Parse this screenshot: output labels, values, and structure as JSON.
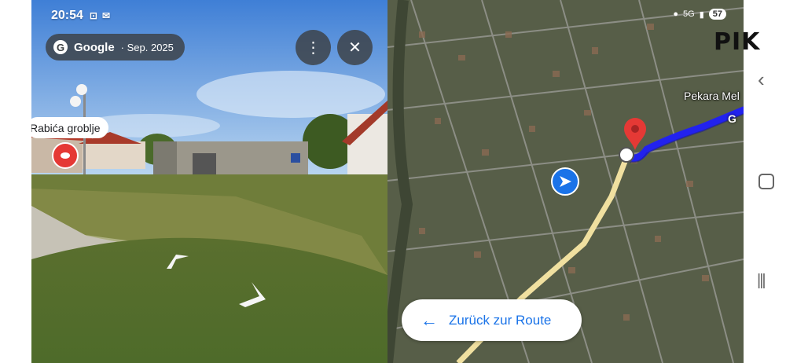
{
  "status_bar": {
    "time": "20:54",
    "left_icons": [
      "screenshot-icon",
      "mail-icon"
    ],
    "right_icons": [
      "location-icon",
      "5g-icon",
      "signal-icon"
    ],
    "battery": "57"
  },
  "street_view": {
    "brand": "Google",
    "date": "· Sep. 2025",
    "menu_icon": "more-vert-icon",
    "close_icon": "close-icon",
    "place_label": "Rabića groblje"
  },
  "map": {
    "poi_label": "Pekara Mel",
    "road_label": "G",
    "back_button_label": "Zurück zur Route",
    "route_color": "#2222ee"
  },
  "overlay": {
    "watermark": "PIK"
  },
  "system_nav": {
    "back": "‹",
    "recent": "|||"
  }
}
